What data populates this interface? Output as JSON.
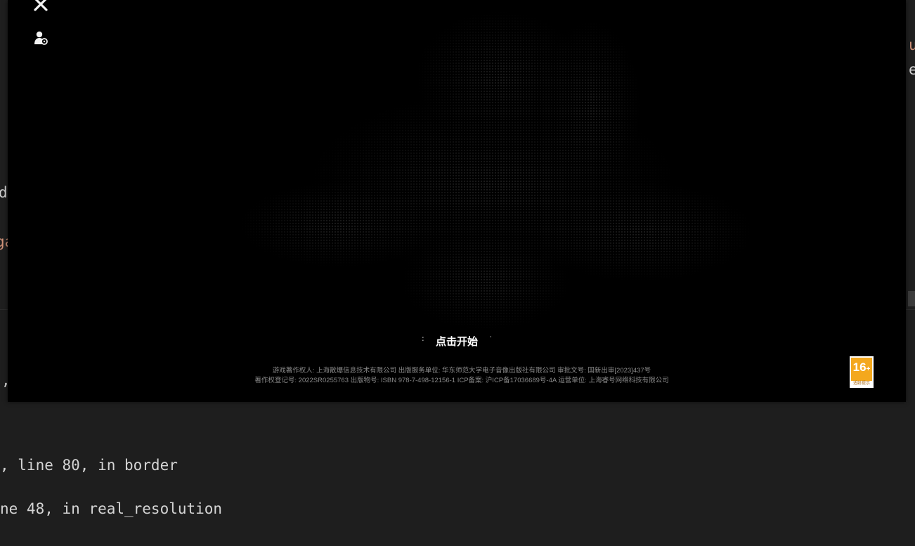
{
  "editor": {
    "fragments": {
      "right_top_1": "u",
      "right_top_2": "e",
      "left_1": "di",
      "left_2": "ga",
      "left_3": ","
    },
    "terminal": {
      "line1": ", line 80, in border",
      "line2": "ne 48, in real_resolution"
    },
    "colors": {
      "fragment_orange": "#ce9178"
    }
  },
  "game": {
    "toolbar": {
      "icons": [
        "tools-icon",
        "user-settings-icon"
      ]
    },
    "start_label": "点击开始",
    "credits": {
      "line1": "游戏著作权人: 上海散爆信息技术有限公司  出版服务单位: 华东师范大学电子音像出版社有限公司  审批文号: 国新出审[2023]437号",
      "line2": "著作权登记号: 2022SR0255763 出版物号: ISBN 978-7-498-12156-1 ICP备案: 沪ICP备17036689号-4A 运营单位: 上海睿号网络科技有限公司"
    },
    "age_rating": {
      "number": "16",
      "plus": "+",
      "label": "适龄提示"
    }
  }
}
